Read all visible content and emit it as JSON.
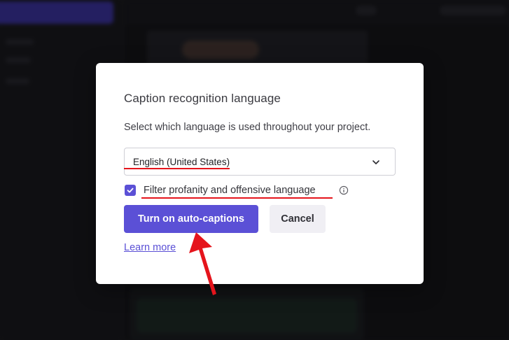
{
  "dialog": {
    "title": "Caption recognition language",
    "description": "Select which language is used throughout your project.",
    "language_select": {
      "value": "English (United States)",
      "icon": "chevron-down-icon"
    },
    "filter_checkbox": {
      "checked": true,
      "label": "Filter profanity and offensive language",
      "info_icon": "info-icon"
    },
    "primary_button": "Turn on auto-captions",
    "cancel_button": "Cancel",
    "learn_more_link": "Learn more"
  },
  "colors": {
    "accent": "#5b50d6",
    "annotation": "#e5141c",
    "dialog_bg": "#ffffff",
    "backdrop": "#1d1d22"
  }
}
